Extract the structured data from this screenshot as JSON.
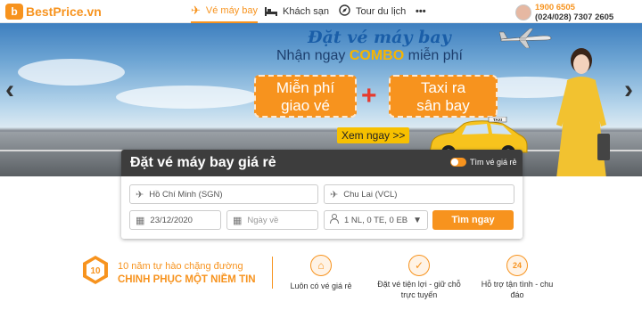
{
  "header": {
    "logo_mark": "b",
    "logo_text": "BestPrice.vn",
    "nav": [
      {
        "label": "Vé máy bay",
        "icon": "airplane-icon",
        "active": true
      },
      {
        "label": "Khách sạn",
        "icon": "bed-icon",
        "active": false
      },
      {
        "label": "Tour du lịch",
        "icon": "compass-icon",
        "active": false
      },
      {
        "label": "•••",
        "icon": "more-icon",
        "active": false
      }
    ],
    "contact": {
      "phone_primary": "1900 6505",
      "phone_secondary": "(024/028) 7307 2605"
    }
  },
  "hero": {
    "title": "Đặt vé máy bay",
    "subtitle_before": "Nhận ngay ",
    "subtitle_highlight": "COMBO",
    "subtitle_after": " miễn phí",
    "tag_left_line1": "Miễn phí",
    "tag_left_line2": "giao vé",
    "plus": "+",
    "tag_right_line1": "Taxi ra",
    "tag_right_line2": "sân bay",
    "cta": "Xem ngay >>",
    "arrow_left": "‹",
    "arrow_right": "›",
    "taxi_sign": "TAXI"
  },
  "search": {
    "title": "Đặt vé máy bay giá rẻ",
    "toggle_label": "Tìm vé giá rẻ",
    "from_value": "Hồ Chí Minh (SGN)",
    "to_value": "Chu Lai (VCL)",
    "depart_date": "23/12/2020",
    "return_placeholder": "Ngày về",
    "passengers": "1 NL, 0 TE, 0 EB",
    "submit_label": "Tìm ngay"
  },
  "trust": {
    "badge_number": "10",
    "line1": "10 năm tự hào chặng đường",
    "line2": "CHINH PHỤC MỘT NIỀM TIN"
  },
  "features": [
    {
      "icon": "price-tag-icon",
      "label_line1": "Luôn có vé giá rẻ",
      "label_line2": ""
    },
    {
      "icon": "checkmark-icon",
      "label_line1": "Đặt vé tiện lợi - giữ chỗ",
      "label_line2": "trực tuyến"
    },
    {
      "icon": "support-24-icon",
      "label_line1": "Hỗ trợ tận tình - chu",
      "label_line2": "đáo"
    }
  ],
  "colors": {
    "accent": "#f7931e",
    "title_blue": "#1a5ea8",
    "dark_bar": "#2d2d2d"
  }
}
